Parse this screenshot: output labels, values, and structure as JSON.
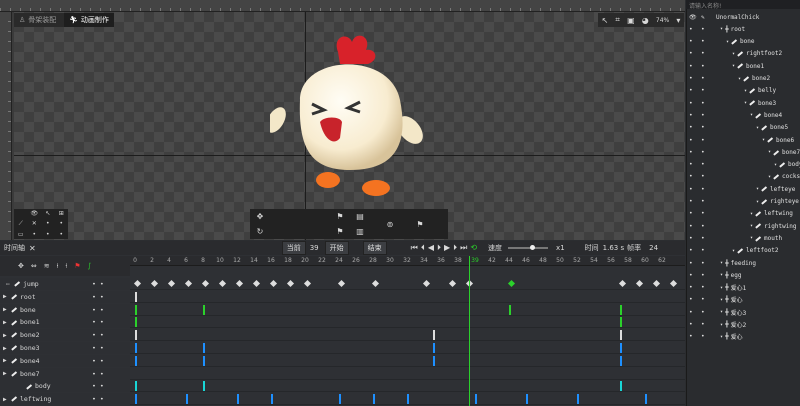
{
  "tabs": [
    {
      "label": "骨架装配",
      "icon": "person-icon"
    },
    {
      "label": "动画制作",
      "icon": "runner-icon"
    }
  ],
  "zoom": "74%",
  "timeline": {
    "title": "时间轴",
    "current_label": "当前",
    "current_value": "39",
    "start_label": "开始",
    "end_label": "结束",
    "speed_label": "速度",
    "speed_value": "x1",
    "time_label": "时间",
    "time_value": "1.63 s",
    "fps_label": "帧率",
    "fps_value": "24",
    "ticks": [
      "0",
      "2",
      "4",
      "6",
      "8",
      "10",
      "12",
      "14",
      "16",
      "18",
      "20",
      "22",
      "24",
      "26",
      "28",
      "30",
      "32",
      "34",
      "36",
      "38",
      "39",
      "42",
      "44",
      "46",
      "48",
      "50",
      "52",
      "54",
      "56",
      "58",
      "60",
      "62"
    ],
    "rows": [
      {
        "name": "jump",
        "type": "anim"
      },
      {
        "name": "root",
        "type": "bone"
      },
      {
        "name": "bone",
        "type": "bone"
      },
      {
        "name": "bone1",
        "type": "bone"
      },
      {
        "name": "bone2",
        "type": "bone"
      },
      {
        "name": "bone3",
        "type": "bone"
      },
      {
        "name": "bone4",
        "type": "bone"
      },
      {
        "name": "bone7",
        "type": "bone"
      },
      {
        "name": "body",
        "type": "slot"
      },
      {
        "name": "leftwing",
        "type": "bone"
      }
    ]
  },
  "hierarchy": {
    "search_placeholder": "请输入名称!",
    "items": [
      {
        "label": "UnormalChick",
        "depth": 0
      },
      {
        "label": "root",
        "depth": 1
      },
      {
        "label": "bone",
        "depth": 2
      },
      {
        "label": "rightfoot2",
        "depth": 3
      },
      {
        "label": "bone1",
        "depth": 3
      },
      {
        "label": "bone2",
        "depth": 4
      },
      {
        "label": "belly",
        "depth": 5
      },
      {
        "label": "bone3",
        "depth": 5
      },
      {
        "label": "bone4",
        "depth": 6
      },
      {
        "label": "bone5",
        "depth": 7
      },
      {
        "label": "bone6",
        "depth": 8
      },
      {
        "label": "bone7",
        "depth": 9
      },
      {
        "label": "body",
        "depth": 10
      },
      {
        "label": "cockscomb",
        "depth": 9
      },
      {
        "label": "lefteye",
        "depth": 7
      },
      {
        "label": "righteye",
        "depth": 7
      },
      {
        "label": "leftwing",
        "depth": 6
      },
      {
        "label": "rightwing",
        "depth": 6
      },
      {
        "label": "mouth",
        "depth": 6
      },
      {
        "label": "leftfoot2",
        "depth": 3
      },
      {
        "label": "feeding",
        "depth": 1
      },
      {
        "label": "egg",
        "depth": 1
      },
      {
        "label": "爱心1",
        "depth": 1
      },
      {
        "label": "爱心",
        "depth": 1
      },
      {
        "label": "爱心3",
        "depth": 1
      },
      {
        "label": "爱心2",
        "depth": 1
      },
      {
        "label": "爱心",
        "depth": 1
      }
    ]
  }
}
